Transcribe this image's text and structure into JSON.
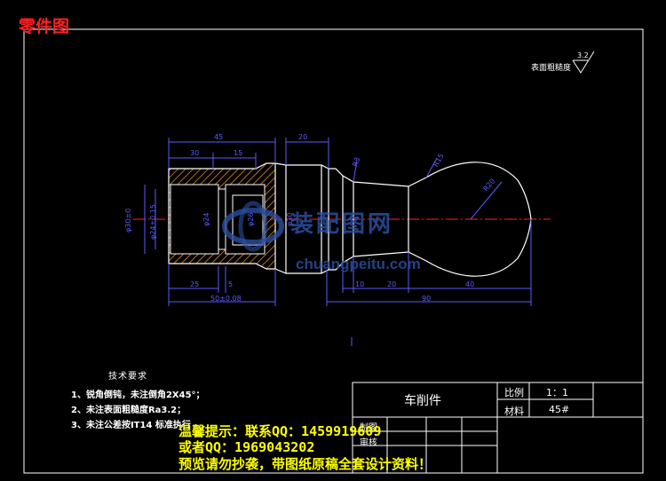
{
  "page_label": "零件图",
  "roughness_note": {
    "label": "表面粗糙度",
    "value": "3.2"
  },
  "dimensions": {
    "top_45": "45",
    "top_30": "30",
    "top_15": "15",
    "top_20": "20",
    "dia_left_1": "φ30±0",
    "dia_left_2": "φ24±0.15",
    "dia_inner_1": "φ24",
    "dia_inner_2": "φ26",
    "dia_mid": "φ30",
    "chamfer_label": "R3",
    "radius_r15": "R15",
    "radius_r20": "R20",
    "bottom_25": "25",
    "bottom_5": "5",
    "bottom_50": "50±0.08",
    "bottom_10": "10",
    "bottom_20": "20",
    "bottom_40": "40",
    "bottom_90": "90"
  },
  "tech_requirements": {
    "title": "技术要求",
    "items": [
      "1、锐角倒钝，未注倒角2X45°；",
      "2、未注表面粗糙度Ra3.2；",
      "3、未注公差按IT14 标准执行"
    ]
  },
  "title_block": {
    "part_name": "车削件",
    "scale_label": "比例",
    "scale_value": "1：1",
    "material_label": "材料",
    "material_value": "45#",
    "drawn_label": "制图",
    "checked_label": "审核"
  },
  "watermark": {
    "text": "装配图网",
    "url": "chuangpeitu.com"
  },
  "promo": {
    "line1": "温馨提示：联系QQ：1459919609",
    "line2": "或者QQ：1969043202",
    "line3": "预览请勿抄袭，带图纸原稿全套设计资料！"
  },
  "colors": {
    "outline": "#ffffff",
    "dimension": "#5a5aff",
    "hatch": "#ff9a2a",
    "centerline": "#ff2020",
    "label_red": "#ff2020",
    "promo_yellow": "#ffff00"
  }
}
